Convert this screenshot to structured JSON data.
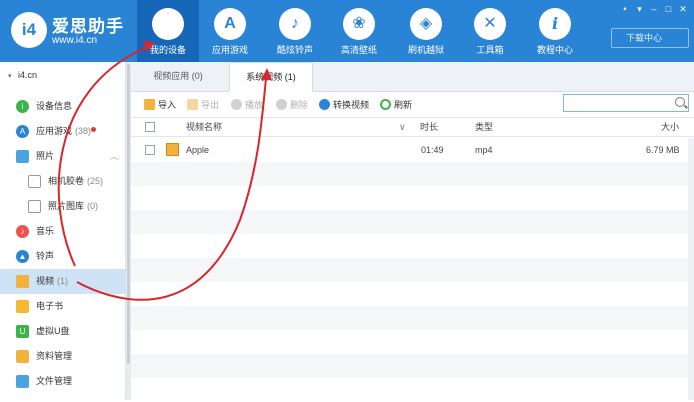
{
  "brand": {
    "logo_text": "i4",
    "name": "爱思助手",
    "url": "www.i4.cn"
  },
  "nav": [
    {
      "label": "我的设备",
      "icon": "apple-icon",
      "glyph": ""
    },
    {
      "label": "应用游戏",
      "icon": "app-store-icon",
      "glyph": "A"
    },
    {
      "label": "酷炫铃声",
      "icon": "bell-icon",
      "glyph": "♪"
    },
    {
      "label": "高清壁纸",
      "icon": "flower-icon",
      "glyph": "❀"
    },
    {
      "label": "刷机越狱",
      "icon": "box-icon",
      "glyph": "◈"
    },
    {
      "label": "工具箱",
      "icon": "tools-icon",
      "glyph": "✕"
    },
    {
      "label": "教程中心",
      "icon": "info-icon",
      "glyph": "i"
    }
  ],
  "window_controls": {
    "menu": "•",
    "skin": "▾",
    "minimize": "–",
    "maximize": "□",
    "close": "✕"
  },
  "download_center": "下载中心",
  "sidebar": {
    "device": "i4.cn",
    "items": [
      {
        "label": "设备信息",
        "count": ""
      },
      {
        "label": "应用游戏",
        "count": "(38)"
      },
      {
        "label": "照片",
        "count": ""
      },
      {
        "label": "相机胶卷",
        "count": "(25)"
      },
      {
        "label": "照片图库",
        "count": "(0)"
      },
      {
        "label": "音乐",
        "count": ""
      },
      {
        "label": "铃声",
        "count": ""
      },
      {
        "label": "视频",
        "count": "(1)"
      },
      {
        "label": "电子书",
        "count": ""
      },
      {
        "label": "虚拟U盘",
        "count": ""
      },
      {
        "label": "资料管理",
        "count": ""
      },
      {
        "label": "文件管理",
        "count": ""
      }
    ]
  },
  "tabs": [
    {
      "label": "视频应用 (0)"
    },
    {
      "label": "系统视频 (1)"
    }
  ],
  "toolbar": {
    "import": "导入",
    "export": "导出",
    "play": "播放",
    "delete": "删除",
    "convert": "转换视频",
    "refresh": "刷新"
  },
  "search": {
    "placeholder": ""
  },
  "table": {
    "headers": {
      "name": "视频名称",
      "duration": "时长",
      "type": "类型",
      "size": "大小"
    },
    "rows": [
      {
        "name": "Apple",
        "duration": "01:49",
        "type": "mp4",
        "size": "6.79 MB"
      }
    ]
  },
  "colors": {
    "accent": "#2a84d6",
    "nav_active": "#1667b7",
    "selected_row": "#cfe3f7",
    "annotation": "#d7262c"
  }
}
